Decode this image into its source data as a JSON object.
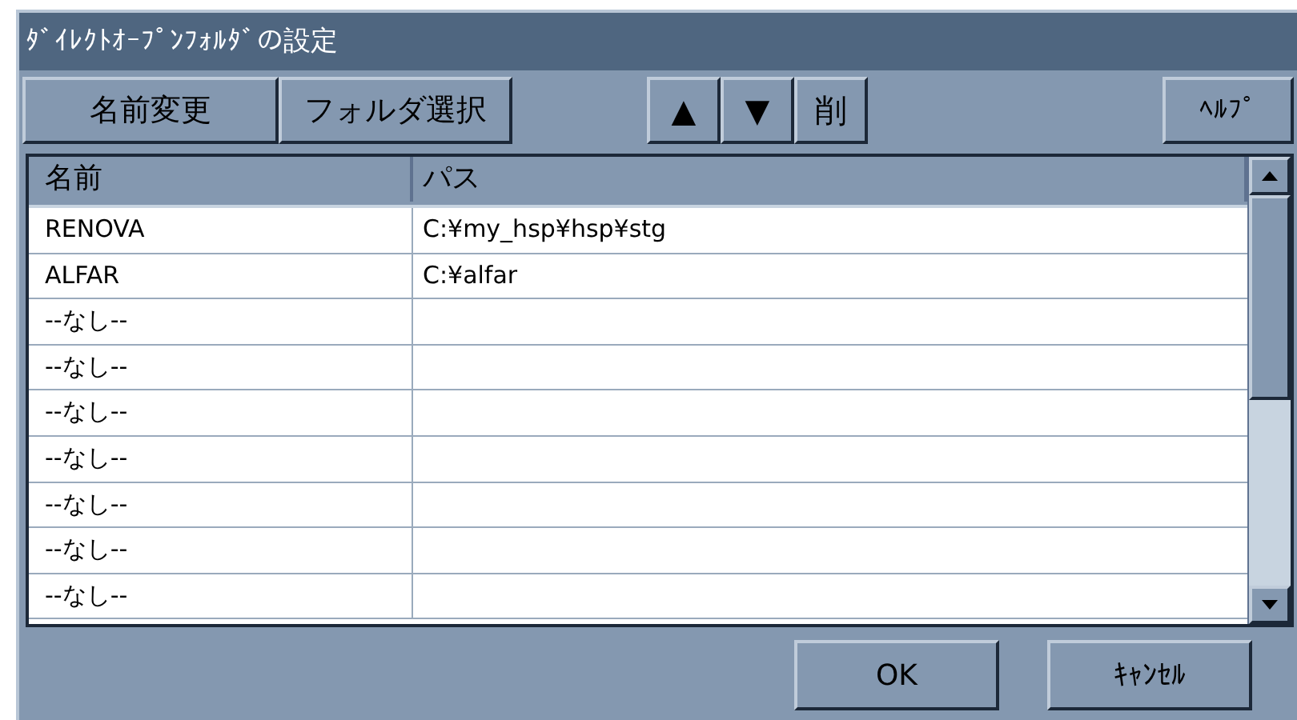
{
  "window": {
    "title": "ﾀﾞｲﾚｸﾄｵｰﾌﾟﾝﾌｫﾙﾀﾞの設定"
  },
  "toolbar": {
    "left": [
      "名前変更",
      "フォルダ選択"
    ],
    "middle": [
      "▲",
      "▼",
      "削"
    ],
    "right": [
      "ﾍﾙﾌﾟ"
    ]
  },
  "table": {
    "columns": [
      "名前",
      "パス"
    ],
    "rows": [
      [
        "RENOVA",
        "C:¥my_hsp¥hsp¥stg"
      ],
      [
        "ALFAR",
        "C:¥alfar"
      ],
      [
        "--なし--",
        ""
      ],
      [
        "--なし--",
        ""
      ],
      [
        "--なし--",
        ""
      ],
      [
        "--なし--",
        ""
      ],
      [
        "--なし--",
        ""
      ],
      [
        "--なし--",
        ""
      ],
      [
        "--なし--",
        ""
      ]
    ]
  },
  "buttons": [
    "OK",
    "ｷｬﾝｾﾙ"
  ]
}
